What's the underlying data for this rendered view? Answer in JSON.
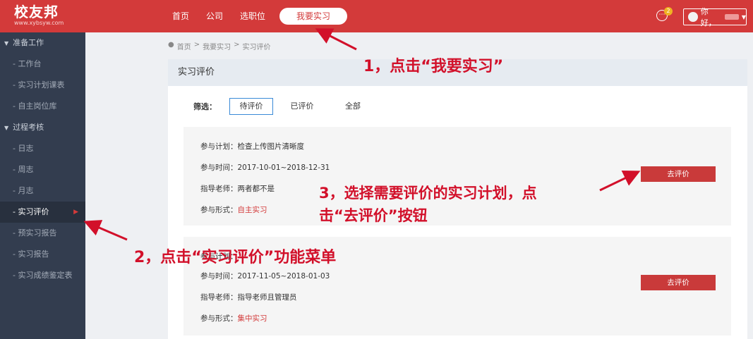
{
  "header": {
    "logo_title": "校友邦",
    "logo_sub": "www.xybsyw.com",
    "nav": [
      "首页",
      "公司",
      "选职位",
      "我要实习"
    ],
    "badge_count": "2",
    "greeting": "你好，"
  },
  "sidebar": {
    "groups": [
      {
        "label": "准备工作",
        "items": [
          "- 工作台",
          "- 实习计划课表",
          "- 自主岗位库"
        ]
      },
      {
        "label": "过程考核",
        "items": [
          "- 日志",
          "- 周志",
          "- 月志",
          "- 实习评价",
          "- 预实习报告",
          "- 实习报告",
          "- 实习成绩鉴定表"
        ]
      }
    ]
  },
  "breadcrumb": [
    "首页",
    ">",
    "我要实习",
    ">",
    "实习评价"
  ],
  "panel_title": "实习评价",
  "filter": {
    "label": "筛选：",
    "options": [
      "待评价",
      "已评价",
      "全部"
    ]
  },
  "cards": [
    {
      "plan_label": "参与计划：",
      "plan": "检查上传图片清晰度",
      "time_label": "参与时间：",
      "time": "2017-10-01~2018-12-31",
      "teacher_label": "指导老师：",
      "teacher": "两者都不是",
      "form_label": "参与形式：",
      "form": "自主实习",
      "button": "去评价"
    },
    {
      "plan_label": "参与计划：",
      "plan": "",
      "time_label": "参与时间：",
      "time": "2017-11-05~2018-01-03",
      "teacher_label": "指导老师：",
      "teacher": "指导老师且管理员",
      "form_label": "参与形式：",
      "form": "集中实习",
      "button": "去评价"
    }
  ],
  "annotations": {
    "a1": "1，点击“我要实习”",
    "a2": "2，点击“实习评价”功能菜单",
    "a3_line1": "3，选择需要评价的实习计划，点",
    "a3_line2": "击“去评价”按钮"
  },
  "colors": {
    "brand": "#d33a3a",
    "sidebar": "#333d4f",
    "annotation": "#d2102a"
  }
}
